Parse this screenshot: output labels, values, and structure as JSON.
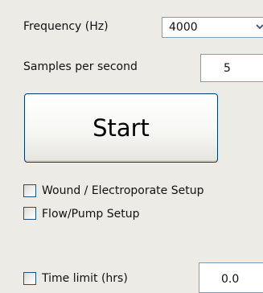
{
  "frequency": {
    "label": "Frequency (Hz)",
    "selected": "4000",
    "arrow_icon": "chevron-down-icon"
  },
  "samples": {
    "label": "Samples per second",
    "value": "5"
  },
  "start_button": {
    "label": "Start"
  },
  "checkboxes": [
    {
      "label": "Wound / Electroporate Setup",
      "checked": false
    },
    {
      "label": "Flow/Pump Setup",
      "checked": false
    },
    {
      "label": "Time limit (hrs)",
      "checked": false
    }
  ],
  "time_limit": {
    "value": "0.0"
  }
}
